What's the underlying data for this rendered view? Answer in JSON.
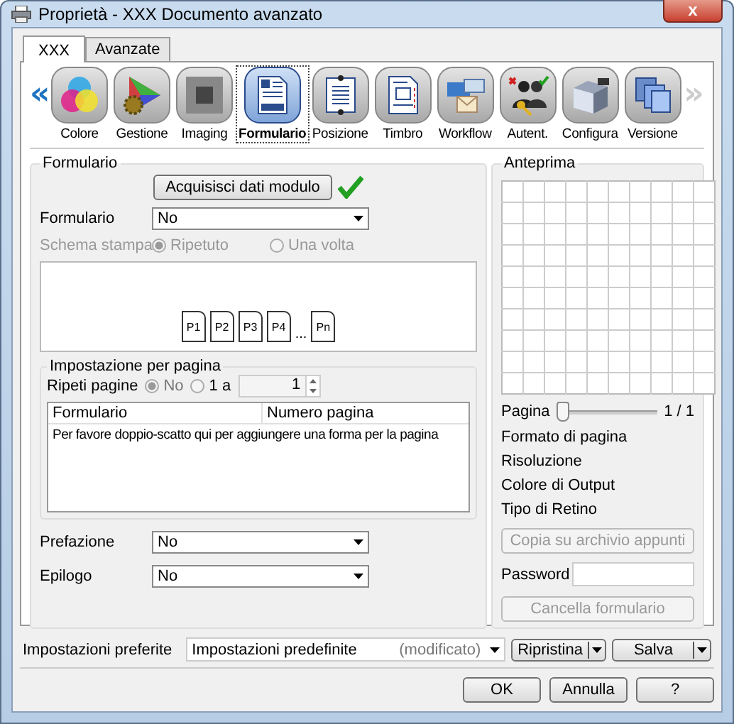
{
  "window": {
    "title": "Proprietà - XXX Documento avanzato",
    "close": "x"
  },
  "tabs": [
    {
      "label": "XXX",
      "selected": true
    },
    {
      "label": "Avanzate",
      "selected": false
    }
  ],
  "toolbar": {
    "prev": {
      "text": "«",
      "disabled": false
    },
    "next": {
      "text": "»",
      "disabled": true
    },
    "items": [
      {
        "label": "Colore",
        "selected": false
      },
      {
        "label": "Gestione",
        "selected": false
      },
      {
        "label": "Imaging",
        "selected": false
      },
      {
        "label": "Formulario",
        "selected": true
      },
      {
        "label": "Posizione",
        "selected": false
      },
      {
        "label": "Timbro",
        "selected": false
      },
      {
        "label": "Workflow",
        "selected": false
      },
      {
        "label": "Autent.",
        "selected": false
      },
      {
        "label": "Configura",
        "selected": false
      },
      {
        "label": "Versione",
        "selected": false
      }
    ]
  },
  "form_section": {
    "title": "Formulario",
    "acquire_button": "Acquisisci dati modulo",
    "acquired": true,
    "formulario": {
      "label": "Formulario",
      "value": "No"
    },
    "print_scheme": {
      "label": "Schema stampa",
      "disabled": true,
      "options": [
        {
          "label": "Ripetuto",
          "selected": true
        },
        {
          "label": "Una volta",
          "selected": false
        }
      ]
    },
    "pages": [
      "P1",
      "P2",
      "P3",
      "P4"
    ],
    "ellipsis": "...",
    "last_page": "Pn"
  },
  "per_page": {
    "title": "Impostazione per pagina",
    "repeat": {
      "label": "Ripeti pagine",
      "options": [
        {
          "label": "No",
          "selected": true
        },
        {
          "label": "1 a",
          "selected": false
        }
      ],
      "value": "1"
    },
    "table": {
      "columns": [
        "Formulario",
        "Numero pagina"
      ],
      "hint": "Per favore doppio-scatto qui per aggiungere una forma per la pagina"
    }
  },
  "prefazione": {
    "label": "Prefazione",
    "value": "No"
  },
  "epilogo": {
    "label": "Epilogo",
    "value": "No"
  },
  "preview": {
    "title": "Anteprima",
    "page_label": "Pagina",
    "level": 0,
    "page_reading": "1 / 1",
    "info": [
      "Formato di pagina",
      "Risoluzione",
      "Colore di Output",
      "Tipo di Retino"
    ],
    "copy_button": {
      "label": "Copia su archivio appunti",
      "disabled": true
    },
    "password_label": "Password",
    "clear_button": {
      "label": "Cancella formulario",
      "disabled": true
    }
  },
  "favorites": {
    "label": "Impostazioni preferite",
    "value": "Impostazioni predefinite",
    "modified": "(modificato)",
    "restore": "Ripristina",
    "save": "Salva"
  },
  "buttons": [
    "OK",
    "Annulla",
    "?"
  ]
}
